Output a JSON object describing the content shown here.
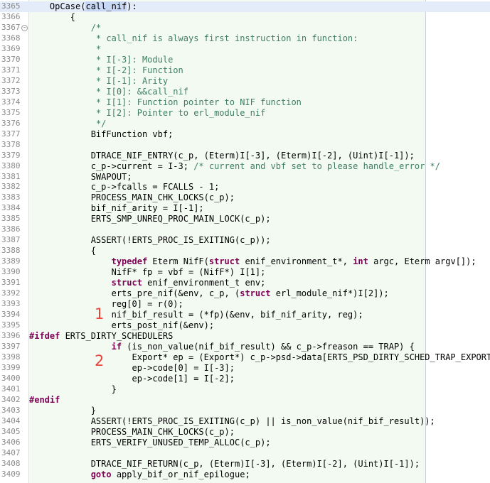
{
  "editor": {
    "current_line": 3365,
    "colors": {
      "keyword": "#7f0055",
      "comment": "#3f7f5f",
      "marker": "#e8453c",
      "background": "#f3faf2",
      "current_line": "#e4ecfa"
    },
    "lines": [
      {
        "n": "3365",
        "segs": [
          [
            "    OpCase(",
            ""
          ],
          [
            "call_nif",
            "sel"
          ],
          [
            "):",
            ""
          ]
        ]
      },
      {
        "n": "3366",
        "segs": [
          [
            "        {",
            ""
          ]
        ]
      },
      {
        "n": "3367",
        "fold": true,
        "segs": [
          [
            "            /*",
            "cm"
          ]
        ]
      },
      {
        "n": "3368",
        "segs": [
          [
            "             * call_nif is always first instruction in function:",
            "cm"
          ]
        ]
      },
      {
        "n": "3369",
        "segs": [
          [
            "             *",
            "cm"
          ]
        ]
      },
      {
        "n": "3370",
        "segs": [
          [
            "             * I[-3]: Module",
            "cm"
          ]
        ]
      },
      {
        "n": "3371",
        "segs": [
          [
            "             * I[-2]: Function",
            "cm"
          ]
        ]
      },
      {
        "n": "3372",
        "segs": [
          [
            "             * I[-1]: Arity",
            "cm"
          ]
        ]
      },
      {
        "n": "3373",
        "segs": [
          [
            "             * I[0]: &&call_nif",
            "cm"
          ]
        ]
      },
      {
        "n": "3374",
        "segs": [
          [
            "             * I[1]: Function pointer to NIF function",
            "cm"
          ]
        ]
      },
      {
        "n": "3375",
        "segs": [
          [
            "             * I[2]: Pointer to erl_module_nif",
            "cm"
          ]
        ]
      },
      {
        "n": "3376",
        "segs": [
          [
            "             */",
            "cm"
          ]
        ]
      },
      {
        "n": "3377",
        "segs": [
          [
            "            BifFunction vbf;",
            ""
          ]
        ]
      },
      {
        "n": "3378",
        "segs": []
      },
      {
        "n": "3379",
        "segs": [
          [
            "            DTRACE_NIF_ENTRY(c_p, (Eterm)I[-3], (Eterm)I[-2], (Uint)I[-1]);",
            ""
          ]
        ]
      },
      {
        "n": "3380",
        "segs": [
          [
            "            c_p->current = I-3; ",
            ""
          ],
          [
            "/* current and vbf set to please handle_error */",
            "cm"
          ]
        ]
      },
      {
        "n": "3381",
        "segs": [
          [
            "            SWAPOUT;",
            ""
          ]
        ]
      },
      {
        "n": "3382",
        "segs": [
          [
            "            c_p->fcalls = FCALLS - 1;",
            ""
          ]
        ]
      },
      {
        "n": "3383",
        "segs": [
          [
            "            PROCESS_MAIN_CHK_LOCKS(c_p);",
            ""
          ]
        ]
      },
      {
        "n": "3384",
        "segs": [
          [
            "            bif_nif_arity = I[-1];",
            ""
          ]
        ]
      },
      {
        "n": "3385",
        "segs": [
          [
            "            ERTS_SMP_UNREQ_PROC_MAIN_LOCK(c_p);",
            ""
          ]
        ]
      },
      {
        "n": "3386",
        "segs": []
      },
      {
        "n": "3387",
        "segs": [
          [
            "            ASSERT(!ERTS_PROC_IS_EXITING(c_p));",
            ""
          ]
        ]
      },
      {
        "n": "3388",
        "segs": [
          [
            "            {",
            ""
          ]
        ]
      },
      {
        "n": "3389",
        "segs": [
          [
            "                ",
            ""
          ],
          [
            "typedef",
            "kw"
          ],
          [
            " Eterm NifF(",
            ""
          ],
          [
            "struct",
            "kw"
          ],
          [
            " enif_environment_t*, ",
            ""
          ],
          [
            "int",
            "kw"
          ],
          [
            " argc, Eterm argv[]);",
            ""
          ]
        ]
      },
      {
        "n": "3390",
        "segs": [
          [
            "                NifF* fp = vbf = (NifF*) I[1];",
            ""
          ]
        ]
      },
      {
        "n": "3391",
        "segs": [
          [
            "                ",
            ""
          ],
          [
            "struct",
            "kw"
          ],
          [
            " enif_environment_t env;",
            ""
          ]
        ]
      },
      {
        "n": "3392",
        "segs": [
          [
            "                erts_pre_nif(&env, c_p, (",
            ""
          ],
          [
            "struct",
            "kw"
          ],
          [
            " erl_module_nif*)I[2]);",
            ""
          ]
        ]
      },
      {
        "n": "3393",
        "segs": [
          [
            "                reg[0] = r(0);",
            ""
          ]
        ]
      },
      {
        "n": "3394",
        "segs": [
          [
            "                nif_bif_result = (*fp)(&env, bif_nif_arity, reg);",
            ""
          ]
        ]
      },
      {
        "n": "3395",
        "segs": [
          [
            "                erts_post_nif(&env);",
            ""
          ]
        ]
      },
      {
        "n": "3396",
        "segs": [
          [
            "#ifdef",
            "kw"
          ],
          [
            " ERTS_DIRTY_SCHEDULERS",
            ""
          ]
        ]
      },
      {
        "n": "3397",
        "segs": [
          [
            "                ",
            ""
          ],
          [
            "if",
            "kw"
          ],
          [
            " (is_non_value(nif_bif_result) && c_p->freason == TRAP) {",
            ""
          ]
        ]
      },
      {
        "n": "3398",
        "segs": [
          [
            "                    Export* ep = (Export*) c_p->psd->data[ERTS_PSD_DIRTY_SCHED_TRAP_EXPORT];",
            ""
          ]
        ]
      },
      {
        "n": "3399",
        "segs": [
          [
            "                    ep->code[0] = I[-3];",
            ""
          ]
        ]
      },
      {
        "n": "3400",
        "segs": [
          [
            "                    ep->code[1] = I[-2];",
            ""
          ]
        ]
      },
      {
        "n": "3401",
        "segs": [
          [
            "                }",
            ""
          ]
        ]
      },
      {
        "n": "3402",
        "segs": [
          [
            "#endif",
            "kw"
          ]
        ]
      },
      {
        "n": "3403",
        "segs": [
          [
            "            }",
            ""
          ]
        ]
      },
      {
        "n": "3404",
        "segs": [
          [
            "            ASSERT(!ERTS_PROC_IS_EXITING(c_p) || is_non_value(nif_bif_result));",
            ""
          ]
        ]
      },
      {
        "n": "3405",
        "segs": [
          [
            "            PROCESS_MAIN_CHK_LOCKS(c_p);",
            ""
          ]
        ]
      },
      {
        "n": "3406",
        "segs": [
          [
            "            ERTS_VERIFY_UNUSED_TEMP_ALLOC(c_p);",
            ""
          ]
        ]
      },
      {
        "n": "3407",
        "segs": []
      },
      {
        "n": "3408",
        "segs": [
          [
            "            DTRACE_NIF_RETURN(c_p, (Eterm)I[-3], (Eterm)I[-2], (Uint)I[-1]);",
            ""
          ]
        ]
      },
      {
        "n": "3409",
        "segs": [
          [
            "            ",
            ""
          ],
          [
            "goto",
            "kw"
          ],
          [
            " apply_bif_or_nif_epilogue;",
            ""
          ]
        ]
      }
    ]
  },
  "annotations": {
    "marker_1": "1",
    "marker_2": "2"
  }
}
